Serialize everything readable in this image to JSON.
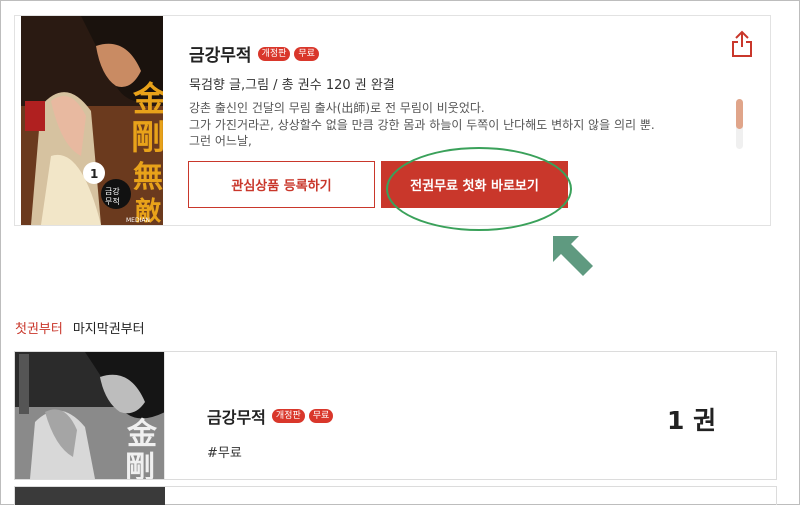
{
  "product": {
    "title": "금강무적",
    "badges": [
      "개정판",
      "무료"
    ],
    "meta": "묵검향 글,그림 / 총 권수 120 권 완결",
    "description": [
      "강촌 출신인 건달의 무림 출사(出師)로 전 무림이 비웃었다.",
      "그가 가진거라곤, 상상할수 없을 만큼 강한 몸과 하늘이 두쪽이 난다해도 변하지 않을 의리 뿐.",
      "그런 어느날,"
    ],
    "wish_button": "관심상품 등록하기",
    "read_button": "전권무료 첫화 바로보기",
    "cover_volume": "1",
    "cover_title_glyphs": "金剛無敵",
    "cover_subtitle": "금강무적",
    "cover_publisher": "MEDIAN"
  },
  "tabs": {
    "first": "첫권부터",
    "last": "마지막권부터"
  },
  "volume": {
    "title": "금강무적",
    "badges": [
      "개정판",
      "무료"
    ],
    "tag": "#무료",
    "number": "1 권"
  },
  "colors": {
    "accent": "#c9372b",
    "annotation": "#3aa15a",
    "arrow": "#5f9a80"
  },
  "icons": {
    "share": "share-icon",
    "arrow": "pointer-arrow-icon"
  }
}
